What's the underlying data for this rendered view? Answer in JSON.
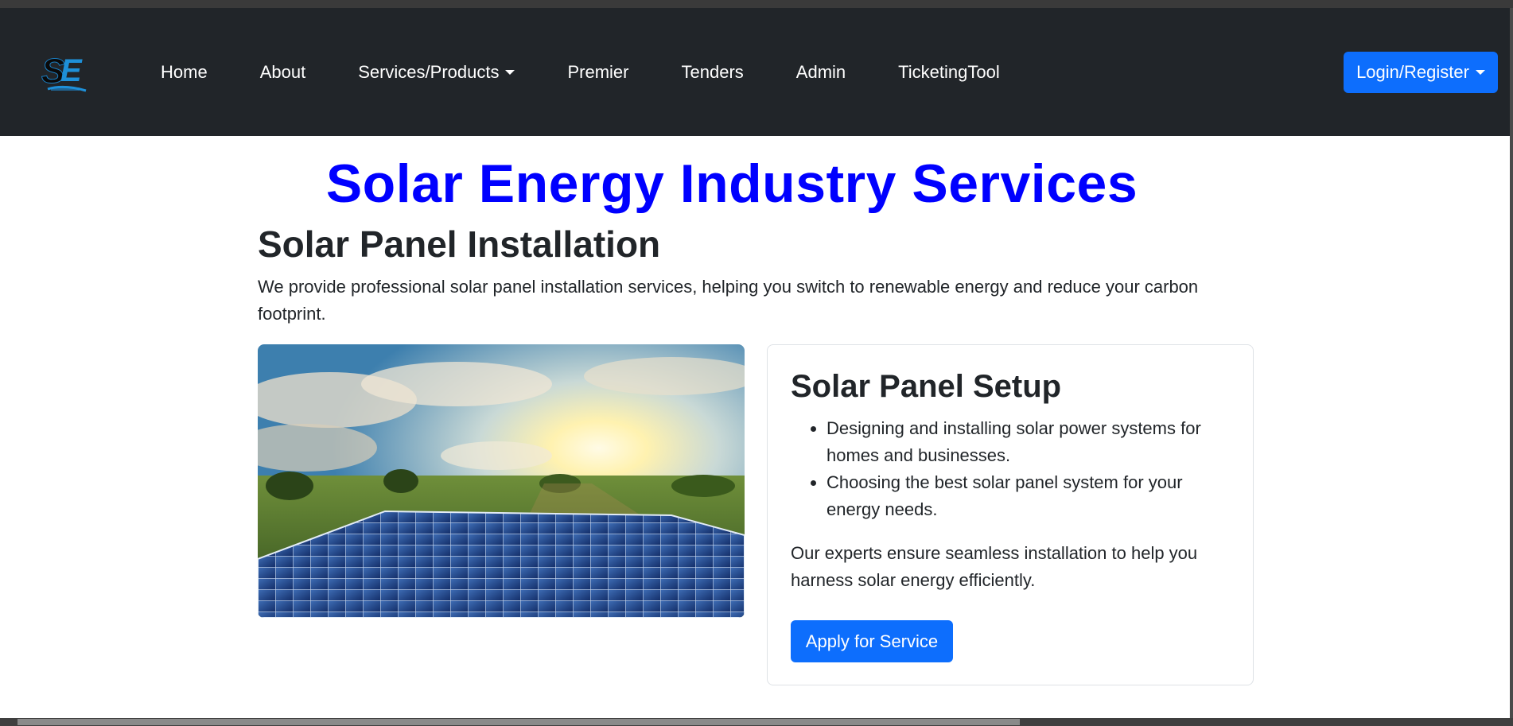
{
  "nav": {
    "logo_icon": "solar-engineers-logo",
    "links": [
      {
        "label": "Home"
      },
      {
        "label": "About"
      },
      {
        "label": "Services/Products",
        "dropdown": true
      },
      {
        "label": "Premier"
      },
      {
        "label": "Tenders"
      },
      {
        "label": "Admin"
      },
      {
        "label": "TicketingTool"
      }
    ],
    "login_label": "Login/Register",
    "bg_color": "#212529",
    "accent": "#0d6efd"
  },
  "page": {
    "title": "Solar Energy Industry Services",
    "title_color": "#0000ff"
  },
  "section": {
    "title": "Solar Panel Installation",
    "description": "We provide professional solar panel installation services, helping you switch to renewable energy and reduce your carbon footprint."
  },
  "card": {
    "title": "Solar Panel Setup",
    "bullets": [
      "Designing and installing solar power systems for homes and businesses.",
      "Choosing the best solar panel system for your energy needs."
    ],
    "text": "Our experts ensure seamless installation to help you harness solar energy efficiently.",
    "button_label": "Apply for Service"
  }
}
